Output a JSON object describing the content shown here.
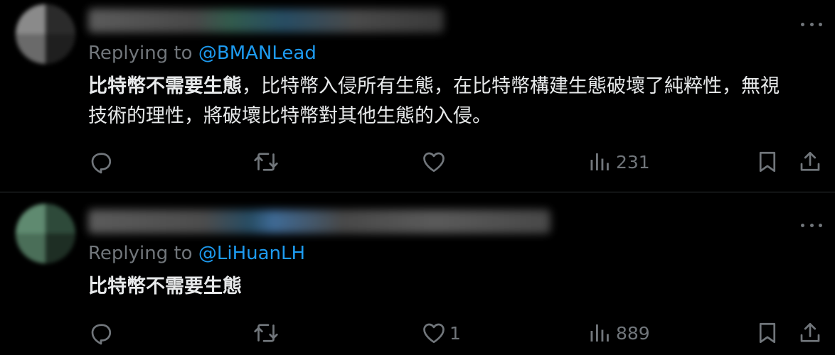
{
  "tweets": [
    {
      "replying_prefix": "Replying to ",
      "replying_to": "@BMANLead",
      "text_bold": "比特幣不需要生態",
      "text_rest": "，比特幣入侵所有生態，在比特幣構建生態破壞了純粹性，無視技術的理性，將破壞比特幣對其他生態的入侵。",
      "reply_count": "",
      "retweet_count": "",
      "like_count": "",
      "view_count": "231"
    },
    {
      "replying_prefix": "Replying to ",
      "replying_to": "@LiHuanLH",
      "text_bold": "比特幣不需要生態",
      "text_rest": "",
      "reply_count": "",
      "retweet_count": "",
      "like_count": "1",
      "view_count": "889"
    }
  ],
  "icons": {
    "reply": "reply-icon",
    "retweet": "retweet-icon",
    "like": "heart-icon",
    "views": "views-chart-icon",
    "bookmark": "bookmark-icon",
    "share": "share-icon",
    "more": "more-dots-icon"
  },
  "colors": {
    "background": "#000000",
    "text": "#e7e9ea",
    "muted": "#71767b",
    "mention": "#1d9bf0",
    "divider": "#2f3336"
  }
}
